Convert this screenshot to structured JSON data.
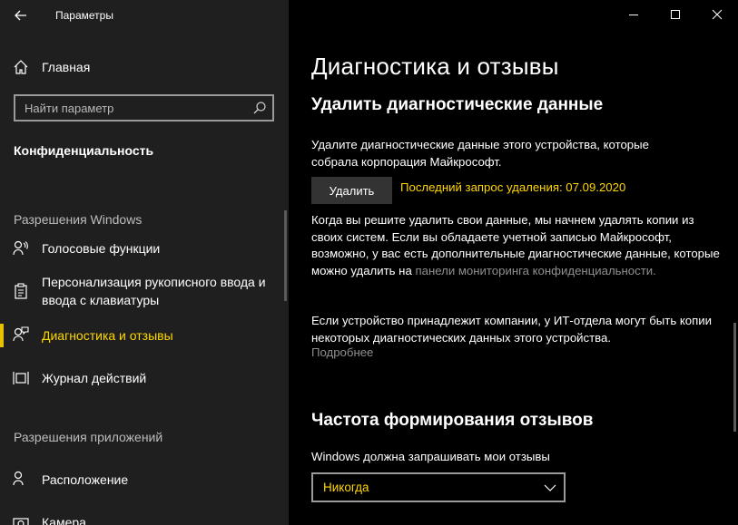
{
  "window": {
    "title": "Параметры"
  },
  "sidebar": {
    "home_label": "Главная",
    "search_placeholder": "Найти параметр",
    "section_title": "Конфиденциальность",
    "groups": [
      {
        "label": "Разрешения Windows",
        "items": [
          {
            "label": "Голосовые функции",
            "icon": "microphone-icon",
            "active": false
          },
          {
            "label": "Персонализация рукописного ввода и ввода с клавиатуры",
            "icon": "clipboard-icon",
            "active": false
          },
          {
            "label": "Диагностика и отзывы",
            "icon": "feedback-person-icon",
            "active": true
          },
          {
            "label": "Журнал действий",
            "icon": "timeline-icon",
            "active": false
          }
        ]
      },
      {
        "label": "Разрешения приложений",
        "items": [
          {
            "label": "Расположение",
            "icon": "location-person-icon",
            "active": false
          },
          {
            "label": "Камера",
            "icon": "camera-icon",
            "active": false
          }
        ]
      }
    ]
  },
  "main": {
    "title": "Диагностика и отзывы",
    "delete_section": {
      "heading": "Удалить диагностические данные",
      "description": "Удалите диагностические данные этого устройства, которые собрала корпорация Майкрософт.",
      "button_label": "Удалить",
      "last_request": "Последний запрос удаления: 07.09.2020",
      "para2_text": "Когда вы решите удалить свои данные, мы начнем удалять копии из своих систем. Если вы обладаете учетной записью Майкрософт, возможно, у вас есть дополнительные диагностические данные, которые можно удалить на ",
      "para2_link": "панели мониторинга конфиденциальности.",
      "para3": "Если устройство принадлежит компании, у ИТ-отдела могут быть копии некоторых диагностических данных этого устройства.",
      "more_link": "Подробнее"
    },
    "frequency_section": {
      "heading": "Частота формирования отзывов",
      "label": "Windows должна запрашивать мои отзывы",
      "selected": "Никогда"
    }
  },
  "colors": {
    "accent": "#ffd700",
    "sidebar_bg": "#1f1f1f",
    "main_bg": "#000000",
    "link": "#8f8f8f"
  }
}
